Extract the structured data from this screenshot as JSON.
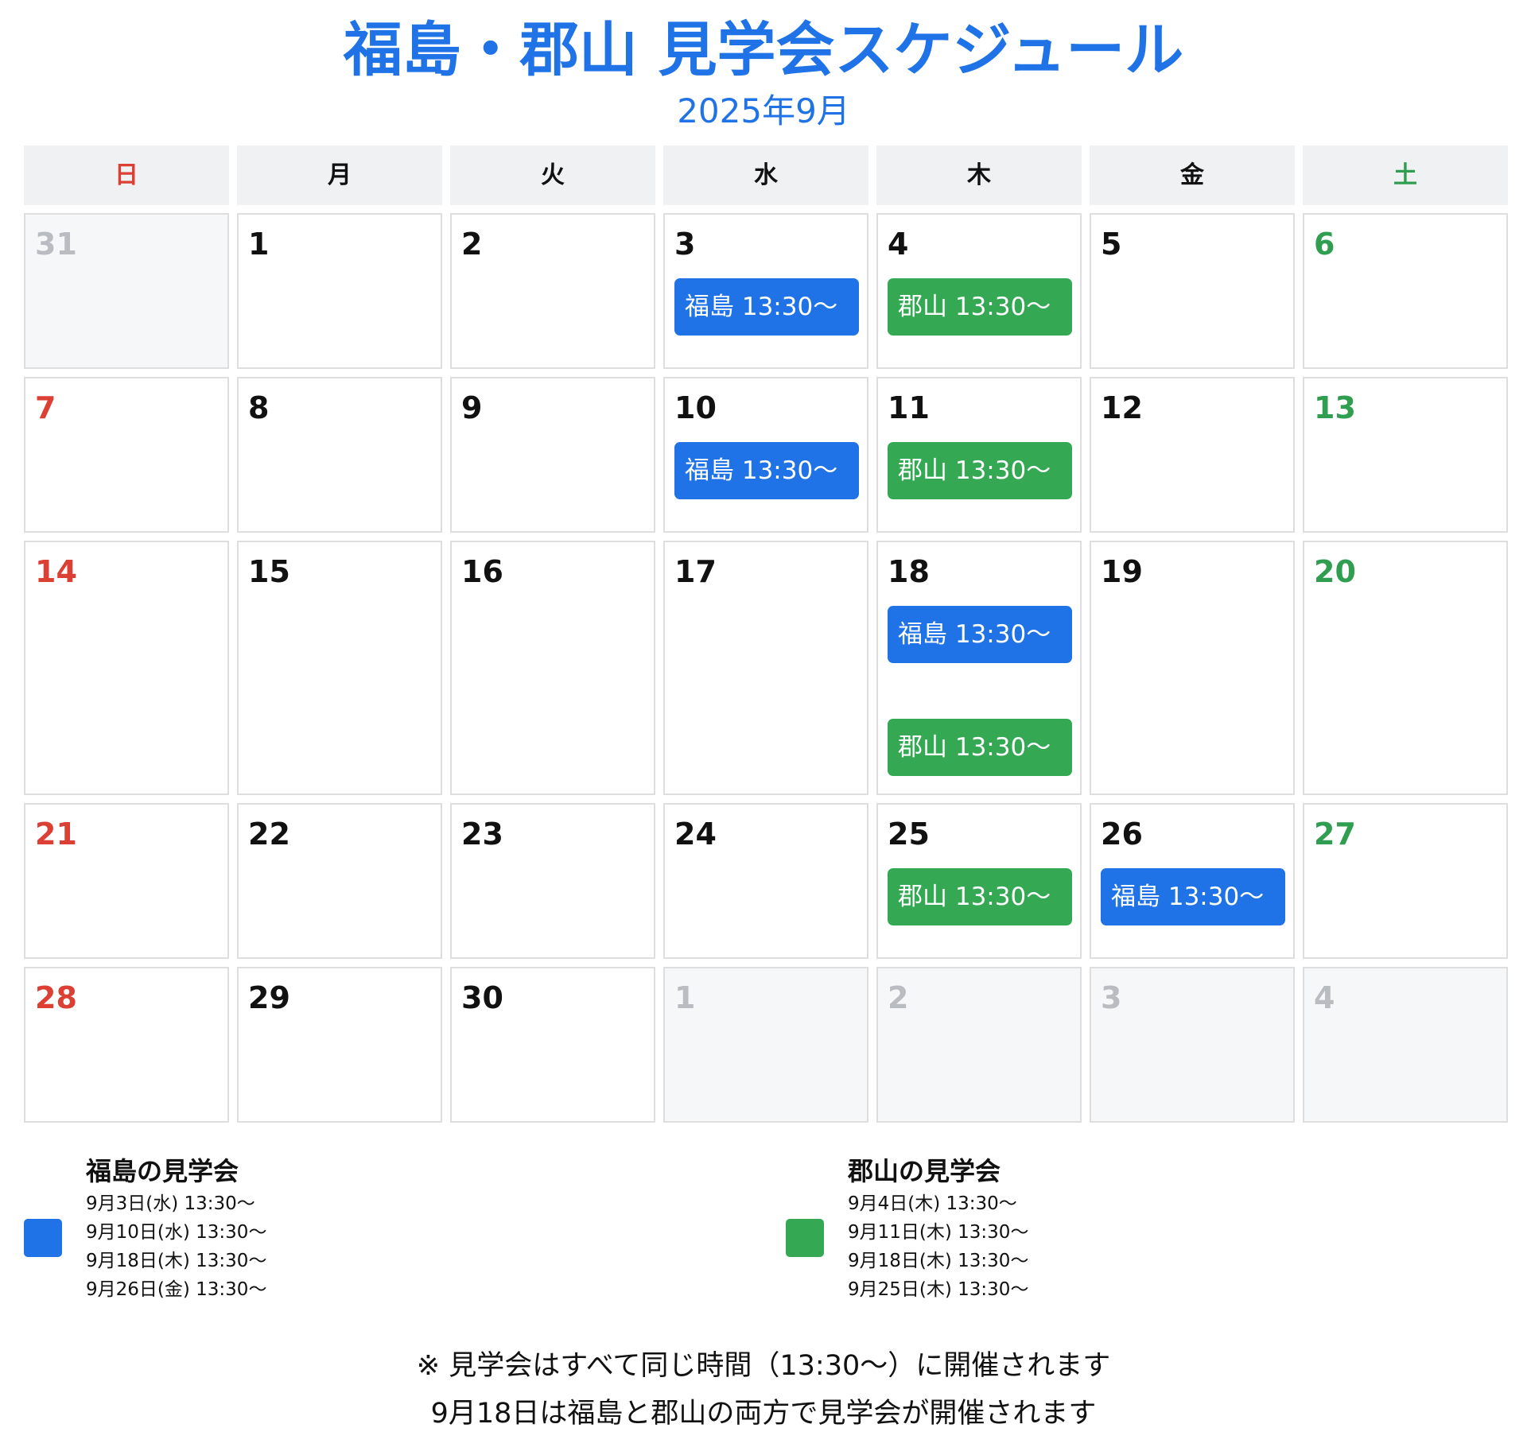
{
  "header": {
    "title": "福島・郡山 見学会スケジュール",
    "subtitle": "2025年9月"
  },
  "colors": {
    "fukushima": "#1f73e6",
    "koriyama": "#34a853",
    "sunday": "#dc3f33",
    "saturday": "#2f9e50"
  },
  "weekdays": [
    "日",
    "月",
    "火",
    "水",
    "木",
    "金",
    "土"
  ],
  "calendar": {
    "weeks": [
      [
        {
          "day": "31",
          "other": true,
          "events": []
        },
        {
          "day": "1",
          "events": []
        },
        {
          "day": "2",
          "events": []
        },
        {
          "day": "3",
          "events": [
            {
              "label": "福島 13:30〜",
              "type": "fk"
            }
          ]
        },
        {
          "day": "4",
          "events": [
            {
              "label": "郡山 13:30〜",
              "type": "kr"
            }
          ]
        },
        {
          "day": "5",
          "events": []
        },
        {
          "day": "6",
          "events": []
        }
      ],
      [
        {
          "day": "7",
          "events": []
        },
        {
          "day": "8",
          "events": []
        },
        {
          "day": "9",
          "events": []
        },
        {
          "day": "10",
          "events": [
            {
              "label": "福島 13:30〜",
              "type": "fk"
            }
          ]
        },
        {
          "day": "11",
          "events": [
            {
              "label": "郡山 13:30〜",
              "type": "kr"
            }
          ]
        },
        {
          "day": "12",
          "events": []
        },
        {
          "day": "13",
          "events": []
        }
      ],
      [
        {
          "day": "14",
          "events": []
        },
        {
          "day": "15",
          "events": []
        },
        {
          "day": "16",
          "events": []
        },
        {
          "day": "17",
          "events": []
        },
        {
          "day": "18",
          "events": [
            {
              "label": "福島 13:30〜",
              "type": "fk"
            },
            {
              "label": "郡山 13:30〜",
              "type": "kr"
            }
          ]
        },
        {
          "day": "19",
          "events": []
        },
        {
          "day": "20",
          "events": []
        }
      ],
      [
        {
          "day": "21",
          "events": []
        },
        {
          "day": "22",
          "events": []
        },
        {
          "day": "23",
          "events": []
        },
        {
          "day": "24",
          "events": []
        },
        {
          "day": "25",
          "events": [
            {
              "label": "郡山 13:30〜",
              "type": "kr"
            }
          ]
        },
        {
          "day": "26",
          "events": [
            {
              "label": "福島 13:30〜",
              "type": "fk"
            }
          ]
        },
        {
          "day": "27",
          "events": []
        }
      ],
      [
        {
          "day": "28",
          "events": []
        },
        {
          "day": "29",
          "events": []
        },
        {
          "day": "30",
          "events": []
        },
        {
          "day": "1",
          "other": true,
          "events": []
        },
        {
          "day": "2",
          "other": true,
          "events": []
        },
        {
          "day": "3",
          "other": true,
          "events": []
        },
        {
          "day": "4",
          "other": true,
          "events": []
        }
      ]
    ]
  },
  "legend": {
    "fukushima": {
      "title": "福島の見学会",
      "items": [
        "9月3日(水) 13:30〜",
        "9月10日(水) 13:30〜",
        "9月18日(木) 13:30〜",
        "9月26日(金) 13:30〜"
      ]
    },
    "koriyama": {
      "title": "郡山の見学会",
      "items": [
        "9月4日(木) 13:30〜",
        "9月11日(木) 13:30〜",
        "9月18日(木) 13:30〜",
        "9月25日(木) 13:30〜"
      ]
    }
  },
  "notes": [
    "※ 見学会はすべて同じ時間（13:30〜）に開催されます",
    "9月18日は福島と郡山の両方で見学会が開催されます"
  ]
}
